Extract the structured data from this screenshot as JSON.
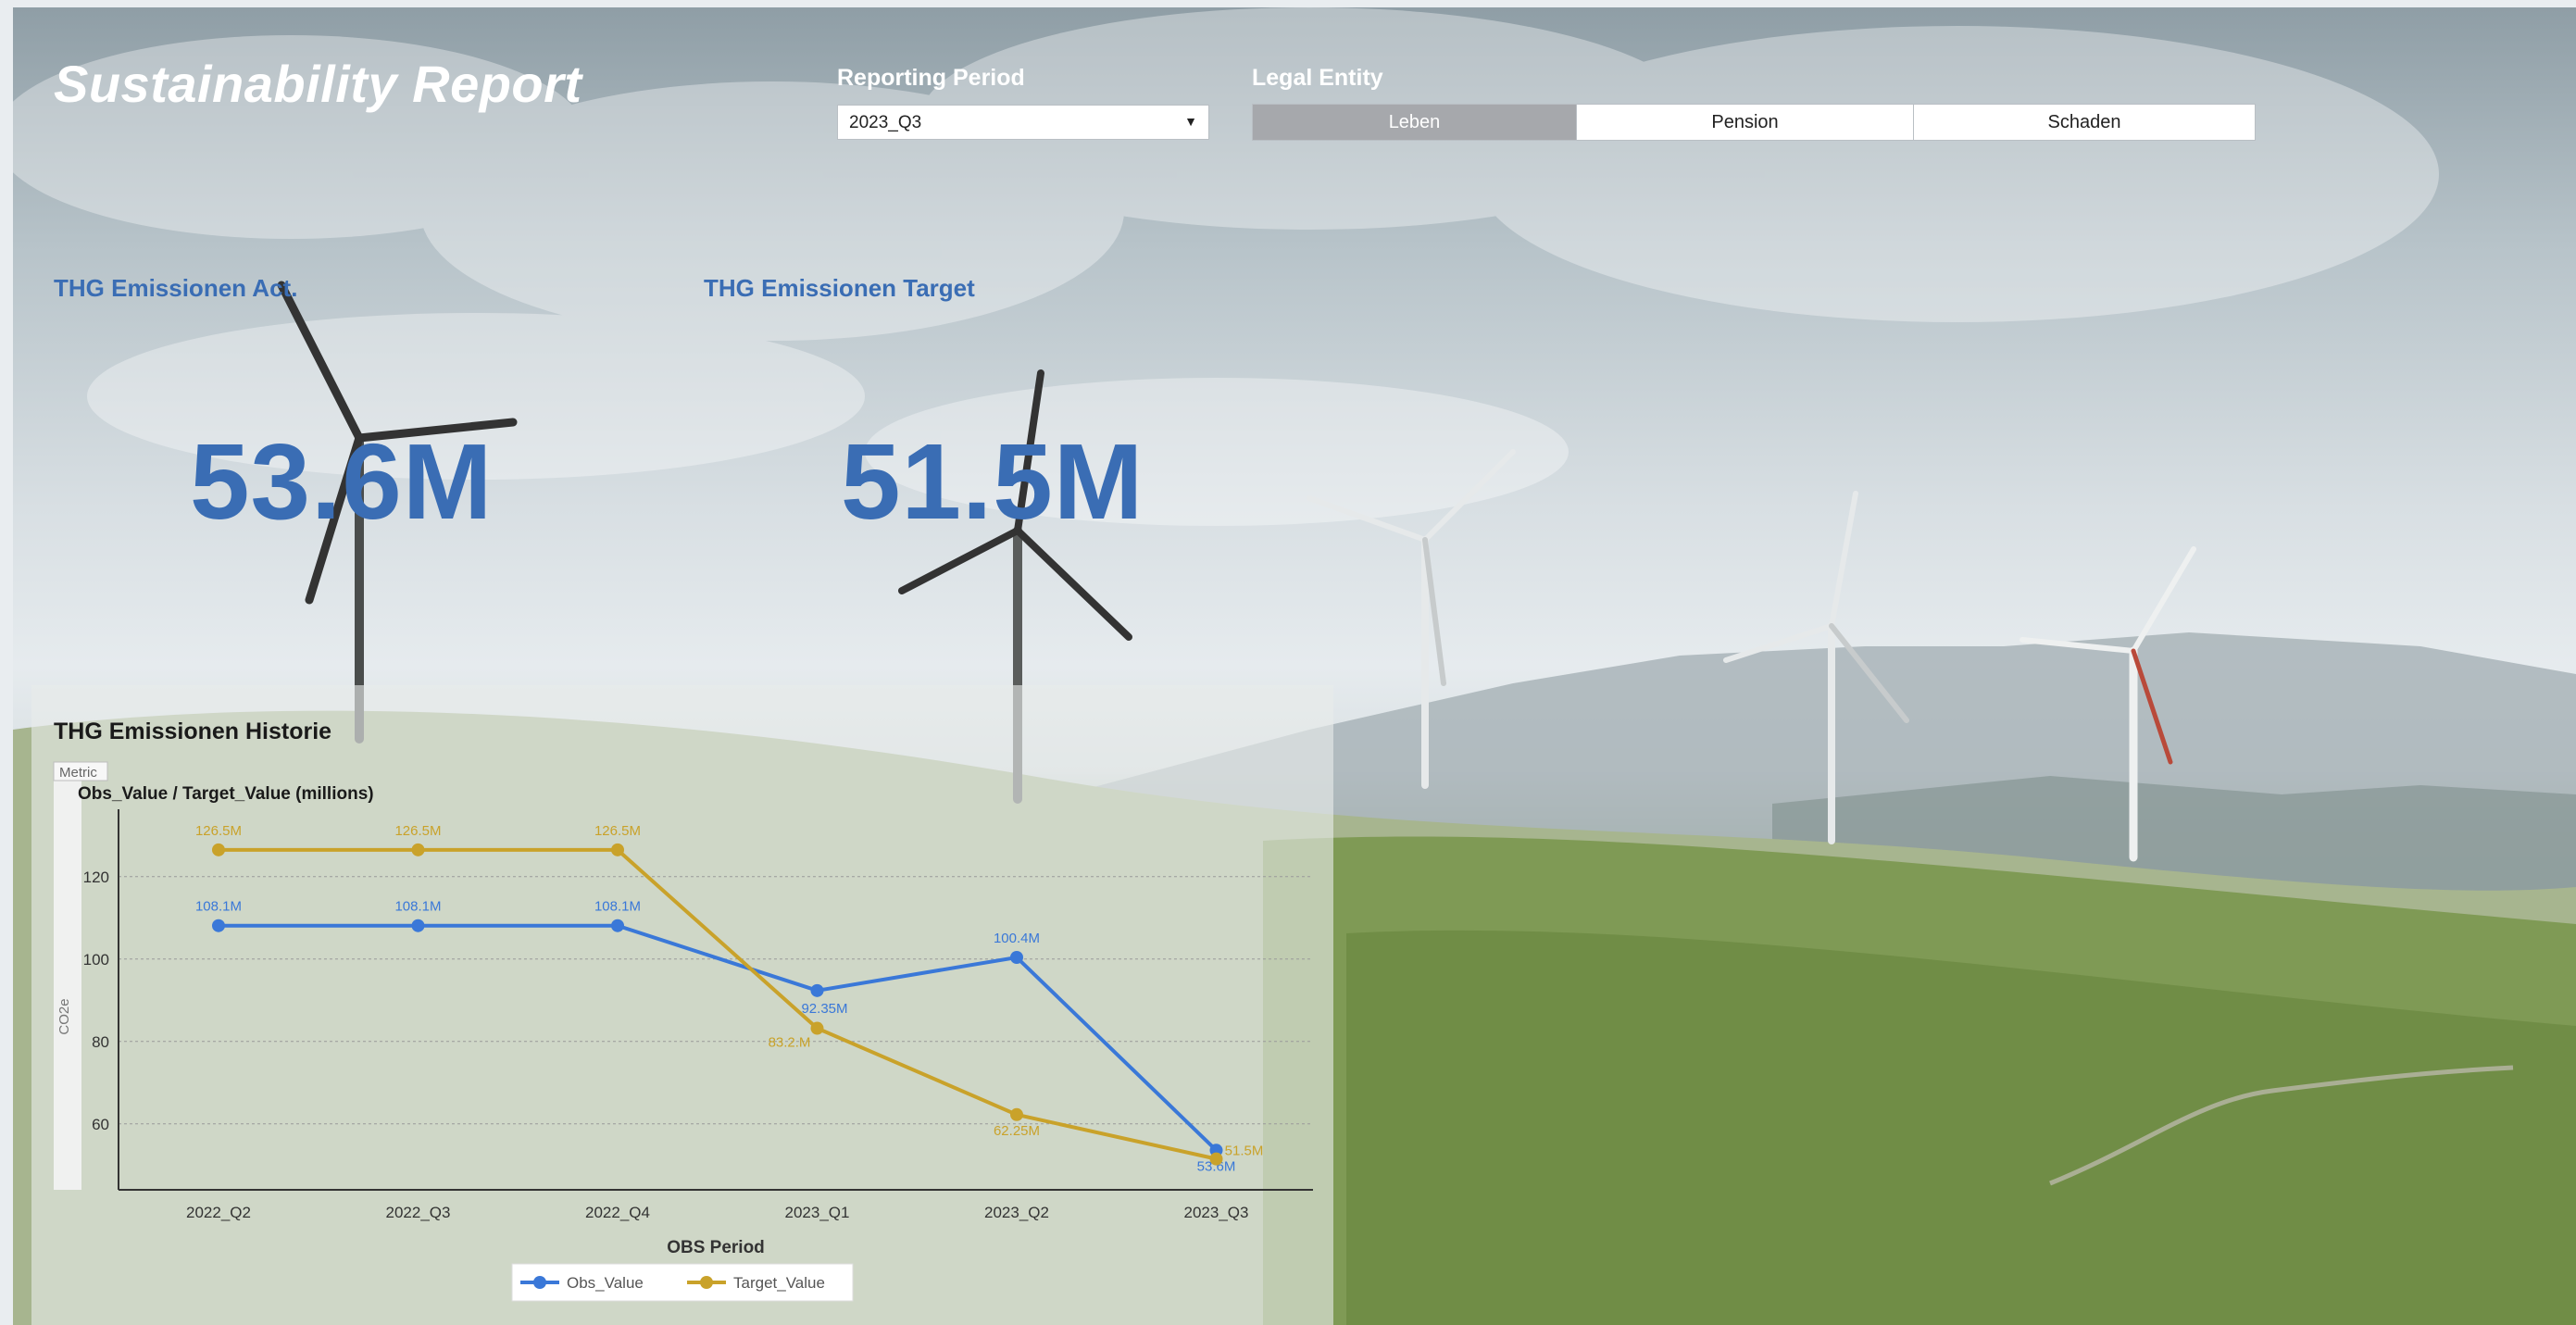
{
  "header": {
    "title": "Sustainability Report",
    "reporting_period_label": "Reporting Period",
    "reporting_period_value": "2023_Q3",
    "legal_entity_label": "Legal Entity",
    "legal_entities": [
      {
        "label": "Leben",
        "active": true
      },
      {
        "label": "Pension",
        "active": false
      },
      {
        "label": "Schaden",
        "active": false
      }
    ]
  },
  "kpis": {
    "actual_label": "THG Emissionen Act.",
    "actual_value": "53.6M",
    "target_label": "THG Emissionen Target",
    "target_value": "51.5M",
    "color": "#3a6db4"
  },
  "history": {
    "title": "THG Emissionen Historie",
    "metric_tab": "Metric",
    "side_label": "CO2e"
  },
  "chart_data": {
    "type": "line",
    "title": "Obs_Value / Target_Value (millions)",
    "xlabel": "OBS Period",
    "ylabel": "",
    "categories": [
      "2022_Q2",
      "2022_Q3",
      "2022_Q4",
      "2023_Q1",
      "2023_Q2",
      "2023_Q3"
    ],
    "yticks": [
      60,
      80,
      100,
      120
    ],
    "ylim": [
      44,
      135
    ],
    "grid": true,
    "legend_position": "bottom",
    "series": [
      {
        "name": "Obs_Value",
        "color": "#3a78d8",
        "values": [
          108.1,
          108.1,
          108.1,
          92.35,
          100.4,
          53.6
        ],
        "labels": [
          "108.1M",
          "108.1M",
          "108.1M",
          "92.35M",
          "100.4M",
          "53.6M"
        ]
      },
      {
        "name": "Target_Value",
        "color": "#c9a22a",
        "values": [
          126.5,
          126.5,
          126.5,
          83.2,
          62.25,
          51.5
        ],
        "labels": [
          "126.5M",
          "126.5M",
          "126.5M",
          "83.2.M",
          "62.25M",
          "51.5M"
        ]
      }
    ]
  }
}
